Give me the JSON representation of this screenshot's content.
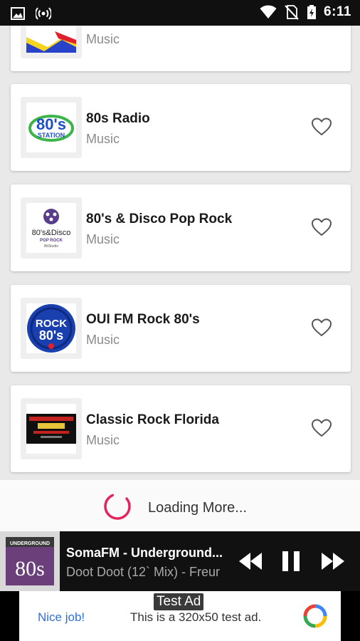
{
  "status_bar": {
    "time": "6:11",
    "left_icons": [
      "image-icon",
      "wireless-broadcast-icon"
    ],
    "right_icons": [
      "wifi-icon",
      "no-sim-icon",
      "battery-charging-icon"
    ]
  },
  "stations": [
    {
      "title": "",
      "genre": "Music",
      "logo": "partial-logo",
      "favorite": false
    },
    {
      "title": "80s Radio",
      "genre": "Music",
      "logo": "80s-station-logo",
      "favorite": false
    },
    {
      "title": "80's & Disco Pop Rock",
      "genre": "Music",
      "logo": "80s-disco-logo",
      "favorite": false
    },
    {
      "title": "OUI FM Rock 80's",
      "genre": "Music",
      "logo": "rock-80s-logo",
      "favorite": false
    },
    {
      "title": "Classic Rock Florida",
      "genre": "Music",
      "logo": "classic-rock-florida-logo",
      "favorite": false
    }
  ],
  "logos": {
    "station80": [
      "80's",
      "STATION"
    ],
    "disco": [
      "80's&Disco",
      "POP ROCK",
      "BitStudio"
    ],
    "rock80": [
      "ROCK",
      "80's"
    ],
    "player_art": [
      "UNDERGROUND",
      "80s"
    ]
  },
  "loading": {
    "text": "Loading More...",
    "accent": "#e5245b"
  },
  "player": {
    "title": "SomaFM - Underground...",
    "subtitle": "Doot Doot (12` Mix) - Freur",
    "controls": [
      "rewind-icon",
      "pause-icon",
      "fast-forward-icon"
    ]
  },
  "ad": {
    "label": "Test Ad",
    "nice": "Nice job!",
    "text": "This is a 320x50 test ad."
  }
}
